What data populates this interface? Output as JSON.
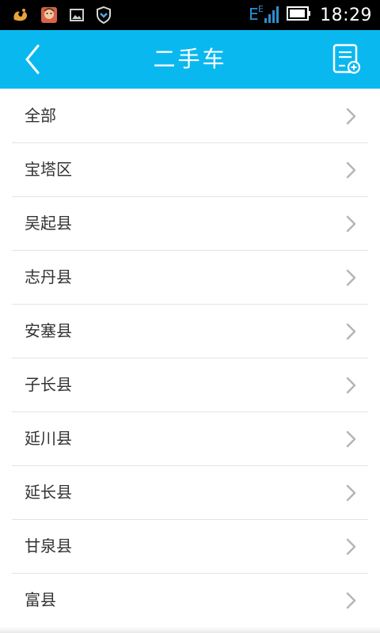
{
  "status_bar": {
    "time": "18:29",
    "network": "E",
    "notification_icons": [
      "uc-browser-icon",
      "avatar-app-icon",
      "gallery-icon",
      "shield-app-icon"
    ]
  },
  "header": {
    "title": "二手车",
    "back_icon": "chevron-left-icon",
    "action_icon": "document-add-icon"
  },
  "list": {
    "items": [
      {
        "label": "全部"
      },
      {
        "label": "宝塔区"
      },
      {
        "label": "吴起县"
      },
      {
        "label": "志丹县"
      },
      {
        "label": "安塞县"
      },
      {
        "label": "子长县"
      },
      {
        "label": "延川县"
      },
      {
        "label": "延长县"
      },
      {
        "label": "甘泉县"
      },
      {
        "label": "富县"
      }
    ]
  },
  "colors": {
    "header_bg": "#0ab8f0",
    "status_bg": "#000000",
    "divider": "#e3e3e3",
    "chevron": "#b5b5b5",
    "text": "#333333"
  }
}
